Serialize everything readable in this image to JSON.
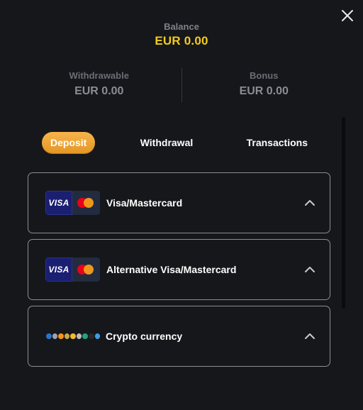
{
  "balance": {
    "label": "Balance",
    "value": "EUR 0.00"
  },
  "withdrawable": {
    "label": "Withdrawable",
    "value": "EUR 0.00"
  },
  "bonus": {
    "label": "Bonus",
    "value": "EUR 0.00"
  },
  "tabs": [
    {
      "label": "Deposit",
      "active": true
    },
    {
      "label": "Withdrawal",
      "active": false
    },
    {
      "label": "Transactions",
      "active": false
    }
  ],
  "methods": [
    {
      "name": "Visa/Mastercard",
      "logo": "visa-mastercard",
      "visa_text": "VISA"
    },
    {
      "name": "Alternative Visa/Mastercard",
      "logo": "visa-mastercard",
      "visa_text": "VISA"
    },
    {
      "name": "Crypto currency",
      "logo": "crypto-coins"
    }
  ],
  "colors": {
    "background": "#16171b",
    "balance_accent": "#f2cc1e",
    "tab_active": "#f0a83a",
    "card_border": "#8b8d94"
  },
  "icons": {
    "close": "close-icon",
    "expand": "chevron-up-icon"
  }
}
